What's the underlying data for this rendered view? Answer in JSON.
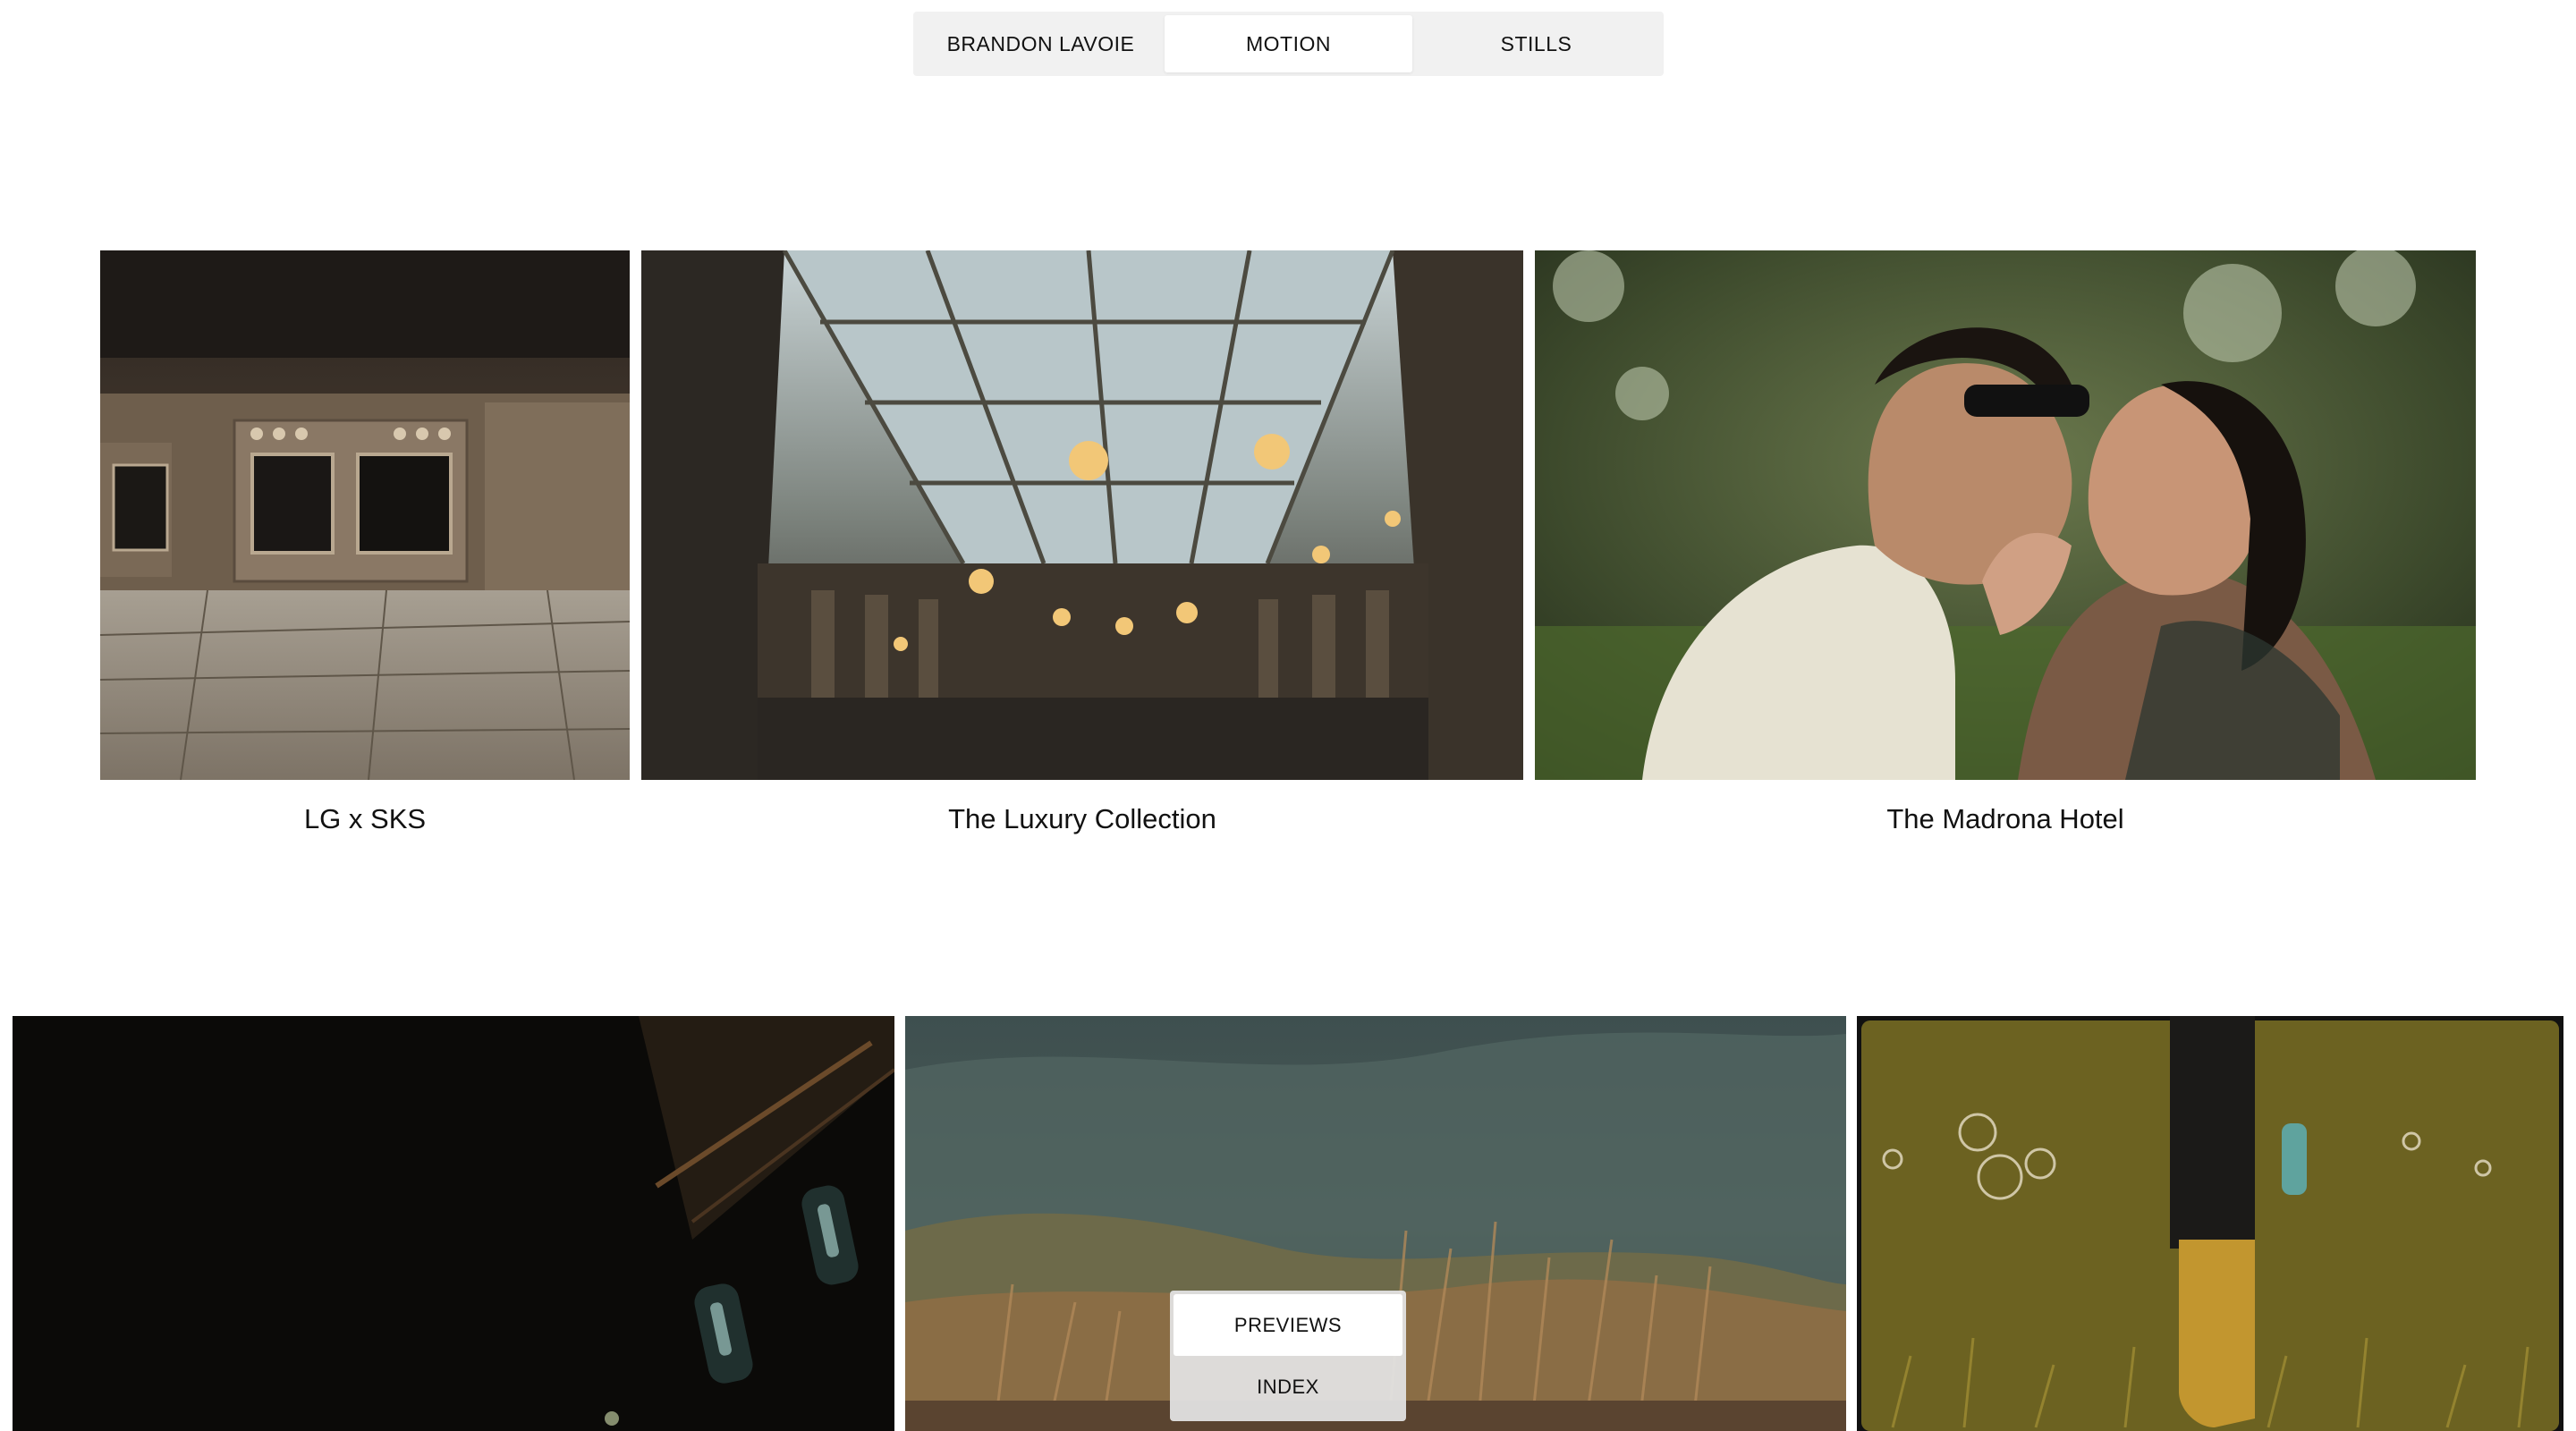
{
  "nav": {
    "tabs": [
      {
        "label": "BRANDON LAVOIE"
      },
      {
        "label": "MOTION",
        "active": true
      },
      {
        "label": "STILLS"
      }
    ]
  },
  "projects": [
    {
      "title": "LG x SKS"
    },
    {
      "title": "The Luxury Collection"
    },
    {
      "title": "The Madrona Hotel"
    }
  ],
  "view_toggle": {
    "options": [
      {
        "label": "PREVIEWS",
        "active": true
      },
      {
        "label": "INDEX"
      }
    ]
  }
}
